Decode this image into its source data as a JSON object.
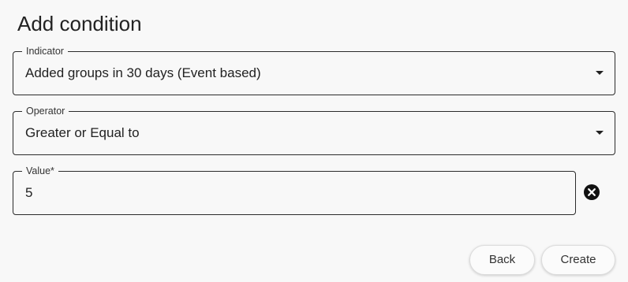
{
  "dialog": {
    "title": "Add condition"
  },
  "indicator": {
    "label": "Indicator",
    "value": "Added groups in 30 days (Event based)"
  },
  "operator": {
    "label": "Operator",
    "value": "Greater or Equal to"
  },
  "value_field": {
    "label": "Value*",
    "value": "5"
  },
  "icons": {
    "dropdown": "caret-down-icon",
    "clear": "clear-circle-icon"
  },
  "actions": {
    "back_label": "Back",
    "create_label": "Create"
  }
}
